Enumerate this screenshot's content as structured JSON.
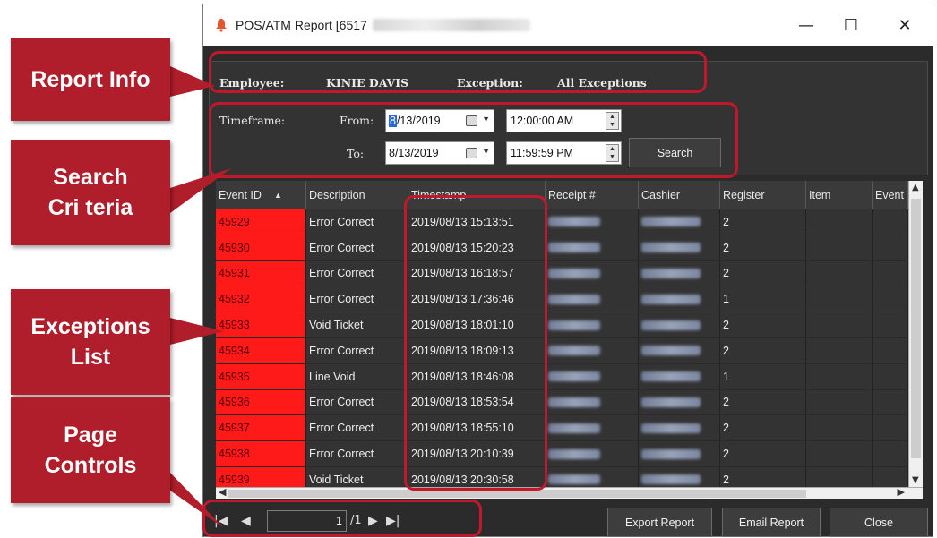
{
  "window": {
    "title": "POS/ATM Report [6517",
    "minimize": "—",
    "maximize": "☐",
    "close": "✕"
  },
  "callouts": {
    "report_info": [
      "Report Info"
    ],
    "search_criteria": [
      "Search",
      "Cri teria"
    ],
    "exceptions_list": [
      "Exceptions",
      "List"
    ],
    "page_controls": [
      "Page",
      "Controls"
    ]
  },
  "report_info": {
    "employee_label": "Employee:",
    "employee_value": "KINIE DAVIS",
    "exception_label": "Exception:",
    "exception_value": "All Exceptions"
  },
  "search": {
    "timeframe_label": "Timeframe:",
    "from_label": "From:",
    "to_label": "To:",
    "from_date_sel": "8",
    "from_date_rest": "/13/2019",
    "from_time": "12:00:00 AM",
    "to_date": "8/13/2019",
    "to_time": "11:59:59 PM",
    "search_button": "Search"
  },
  "grid": {
    "columns": [
      "Event ID",
      "Description",
      "Timestamp",
      "Receipt #",
      "Cashier",
      "Register",
      "Item",
      "Event"
    ],
    "sort_indicator": "▲",
    "rows": [
      {
        "id": "45929",
        "desc": "Error Correct",
        "ts": "2019/08/13 15:13:51",
        "register": "2"
      },
      {
        "id": "45930",
        "desc": "Error Correct",
        "ts": "2019/08/13 15:20:23",
        "register": "2"
      },
      {
        "id": "45931",
        "desc": "Error Correct",
        "ts": "2019/08/13 16:18:57",
        "register": "2"
      },
      {
        "id": "45932",
        "desc": "Error Correct",
        "ts": "2019/08/13 17:36:46",
        "register": "1"
      },
      {
        "id": "45933",
        "desc": "Void Ticket",
        "ts": "2019/08/13 18:01:10",
        "register": "2"
      },
      {
        "id": "45934",
        "desc": "Error Correct",
        "ts": "2019/08/13 18:09:13",
        "register": "2"
      },
      {
        "id": "45935",
        "desc": "Line Void",
        "ts": "2019/08/13 18:46:08",
        "register": "1"
      },
      {
        "id": "45936",
        "desc": "Error Correct",
        "ts": "2019/08/13 18:53:54",
        "register": "2"
      },
      {
        "id": "45937",
        "desc": "Error Correct",
        "ts": "2019/08/13 18:55:10",
        "register": "2"
      },
      {
        "id": "45938",
        "desc": "Error Correct",
        "ts": "2019/08/13 20:10:39",
        "register": "2"
      },
      {
        "id": "45939",
        "desc": "Void Ticket",
        "ts": "2019/08/13 20:30:58",
        "register": "2"
      }
    ]
  },
  "pager": {
    "first": "◀",
    "prev": "◀",
    "page_value": "1",
    "total": "/1",
    "next": "▶",
    "last": "▶"
  },
  "footer": {
    "export_button": "Export Report",
    "email_button": "Email Report",
    "close_button": "Close"
  },
  "colors": {
    "callout": "#b01d2b",
    "outline": "#c1182b",
    "event_id_cell": "#ff1a1a",
    "window_bg": "#2b2b2b"
  }
}
